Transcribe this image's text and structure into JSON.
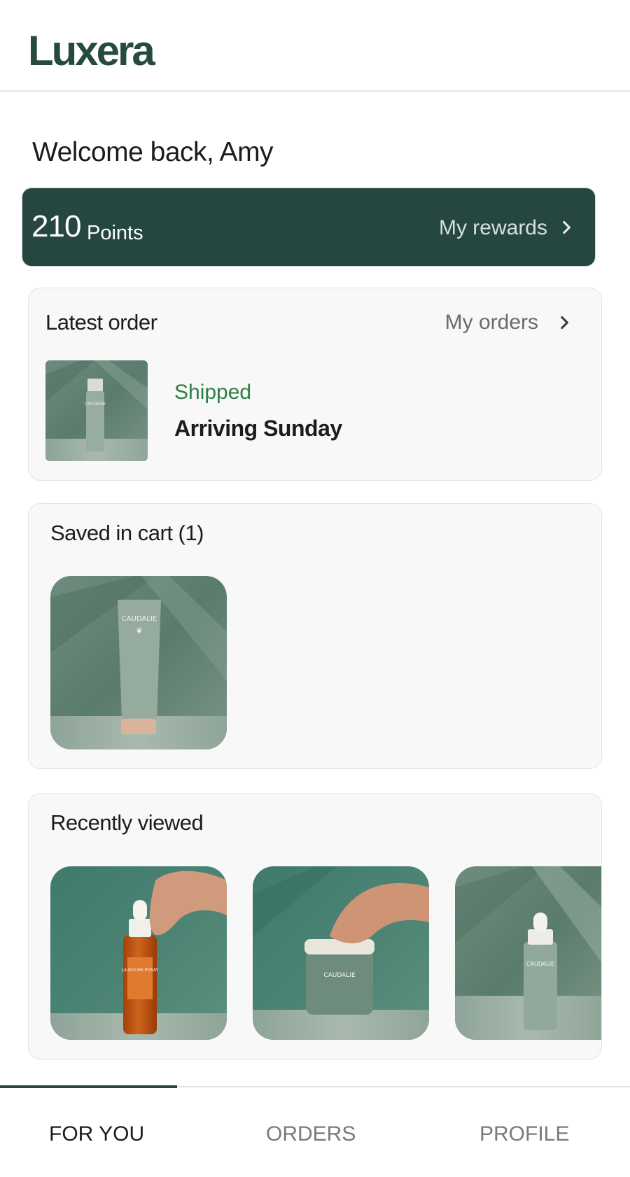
{
  "app": {
    "logo": "Luxera"
  },
  "welcome": "Welcome back, Amy",
  "rewards": {
    "points": "210",
    "points_label": "Points",
    "link": "My rewards"
  },
  "latest_order": {
    "title": "Latest order",
    "link": "My orders",
    "status": "Shipped",
    "arrival": "Arriving Sunday",
    "product_brand": "CAUDALIE"
  },
  "cart": {
    "title": "Saved in cart (1)",
    "product_brand": "CAUDALIE"
  },
  "recent": {
    "title": "Recently viewed",
    "items": [
      {
        "brand": "LA ROCHE-POSAY"
      },
      {
        "brand": "CAUDALIE"
      },
      {
        "brand": "CAUDALIE"
      }
    ]
  },
  "tabs": [
    "FOR YOU",
    "ORDERS",
    "PROFILE"
  ],
  "active_tab": "FOR YOU",
  "colors": {
    "brand": "#264a40",
    "status_shipped": "#2e7d44",
    "background": "#ffffff",
    "card": "#f8f8f8"
  }
}
